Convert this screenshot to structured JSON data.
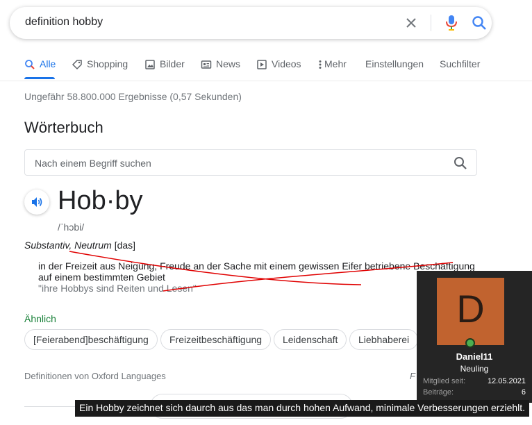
{
  "search": {
    "query": "definition hobby"
  },
  "tabs": [
    {
      "label": "Alle",
      "icon": "search-icon"
    },
    {
      "label": "Shopping",
      "icon": "tag-icon"
    },
    {
      "label": "Bilder",
      "icon": "image-icon"
    },
    {
      "label": "News",
      "icon": "newspaper-icon"
    },
    {
      "label": "Videos",
      "icon": "video-icon"
    },
    {
      "label": "Mehr",
      "icon": "more-vert-icon"
    },
    {
      "label": "Einstellungen"
    },
    {
      "label": "Suchfilter"
    }
  ],
  "result_stats": "Ungefähr 58.800.000 Ergebnisse (0,57 Sekunden)",
  "dictionary": {
    "title": "Wörterbuch",
    "search_placeholder": "Nach einem Begriff suchen",
    "headword": "Hob·by",
    "phonetic": "/ˈhɔbi/",
    "pos_italic": "Substantiv, Neutrum",
    "pos_article": "[das]",
    "definition": "in der Freizeit aus Neigung, Freude an der Sache mit einem gewissen Eifer betriebene Beschäftigung auf einem bestimmten Gebiet",
    "example": "\"ihre Hobbys sind Reiten und Lesen\"",
    "similar_label": "Ähnlich",
    "similar": [
      "[Feierabend]beschäftigung",
      "Freizeitbeschäftigung",
      "Leidenschaft",
      "Liebhaberei"
    ],
    "source": "Definitionen von Oxford Languages",
    "source_right": "F"
  },
  "colors": {
    "accent": "#1a73e8",
    "similar_green": "#188038",
    "scribble_red": "#e00000",
    "avatar_bg": "#c1632f",
    "card_bg": "#252525"
  },
  "profile": {
    "avatar_letter": "D",
    "name": "Daniel11",
    "rank": "Neuling",
    "member_since_label": "Mitglied seit:",
    "member_since": "12.05.2021",
    "posts_label": "Beiträge:",
    "posts": "6"
  },
  "caption": "Ein Hobby zeichnet sich daurch aus das man durch hohen Aufwand, minimale Verbesserungen erziehlt."
}
